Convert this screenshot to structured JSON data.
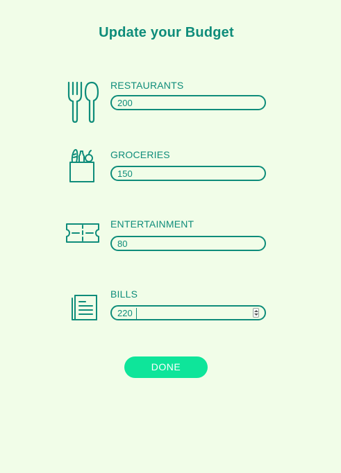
{
  "page": {
    "title": "Update your Budget"
  },
  "categories": [
    {
      "label": "RESTAURANTS",
      "value": "200",
      "icon": "fork-spoon-icon"
    },
    {
      "label": "GROCERIES",
      "value": "150",
      "icon": "grocery-bag-icon"
    },
    {
      "label": "ENTERTAINMENT",
      "value": "80",
      "icon": "ticket-icon"
    },
    {
      "label": "BILLS",
      "value": "220",
      "icon": "bill-document-icon"
    }
  ],
  "actions": {
    "done_label": "DONE"
  },
  "colors": {
    "background": "#f1fde8",
    "primary_text": "#0e8c7a",
    "button": "#0ee59a",
    "button_text": "#ffffff"
  }
}
